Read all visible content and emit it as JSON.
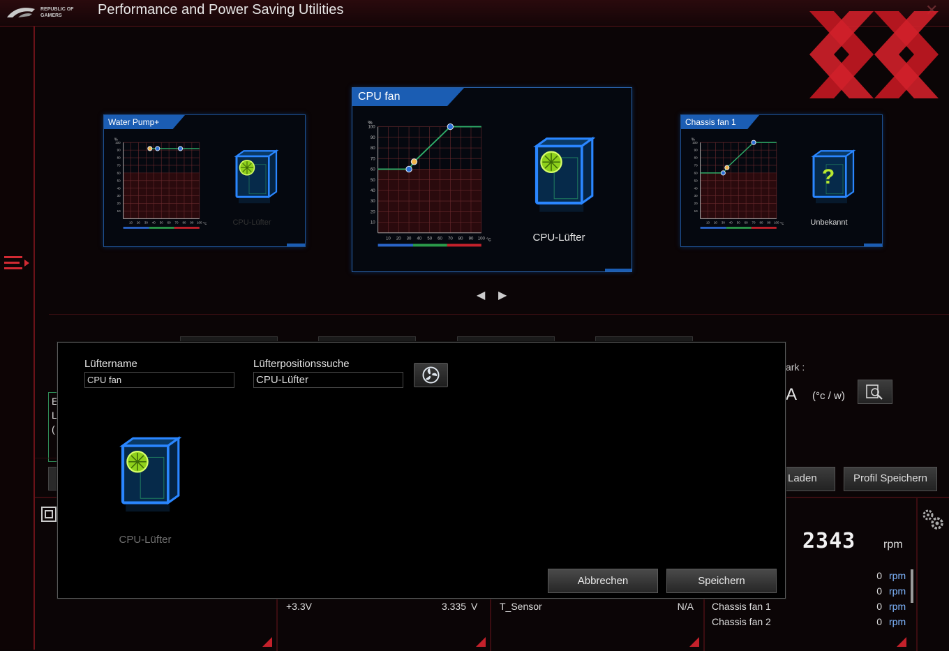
{
  "app": {
    "brand_line1": "REPUBLIC OF",
    "brand_line2": "GAMERS",
    "title": "Performance and Power Saving Utilities",
    "close": "✕"
  },
  "colors": {
    "accent_red": "#c4212b",
    "card_blue": "#1b5db3",
    "fan_green": "#a8e020"
  },
  "fan_cards": {
    "left": {
      "tab": "Water Pump+",
      "fan_label": "CPU-Lüfter"
    },
    "center": {
      "tab": "CPU fan",
      "fan_label": "CPU-Lüfter"
    },
    "right": {
      "tab": "Chassis fan 1",
      "fan_label": "Unbekannt",
      "unknown_glyph": "?"
    }
  },
  "chart_axes": {
    "y_unit": "%",
    "x_unit": "°c",
    "y_ticks": [
      "100",
      "90",
      "80",
      "70",
      "60",
      "50",
      "40",
      "30",
      "20",
      "10"
    ],
    "x_ticks": [
      "10",
      "20",
      "30",
      "40",
      "50",
      "60",
      "70",
      "80",
      "90",
      "100"
    ]
  },
  "chart_data": [
    {
      "type": "line",
      "title": "Water Pump+",
      "xlabel": "°c",
      "ylabel": "%",
      "xlim": [
        0,
        100
      ],
      "ylim": [
        0,
        100
      ],
      "x": [
        35,
        45,
        75,
        100
      ],
      "y": [
        92,
        92,
        92,
        92
      ]
    },
    {
      "type": "line",
      "title": "CPU fan",
      "xlabel": "°c",
      "ylabel": "%",
      "xlim": [
        0,
        100
      ],
      "ylim": [
        0,
        100
      ],
      "x": [
        0,
        30,
        35,
        70,
        100
      ],
      "y": [
        60,
        60,
        67,
        100,
        100
      ]
    },
    {
      "type": "line",
      "title": "Chassis fan 1",
      "xlabel": "°c",
      "ylabel": "%",
      "xlim": [
        0,
        100
      ],
      "ylim": [
        0,
        100
      ],
      "x": [
        0,
        30,
        35,
        70,
        100
      ],
      "y": [
        60,
        60,
        67,
        100,
        100
      ]
    }
  ],
  "nav": {
    "prev": "◀",
    "next": "▶"
  },
  "dialog": {
    "fan_name_label": "Lüftername",
    "fan_name_value": "CPU fan",
    "position_label": "Lüfterpositionssuche",
    "position_value": "CPU-Lüfter",
    "preview_label": "CPU-Lüfter",
    "cancel": "Abbrechen",
    "save": "Speichern"
  },
  "background_right": {
    "mark_label": "ark :",
    "value_partial": "A",
    "unit": "(°c / w)",
    "load_button": "Laden",
    "save_profile_button": "Profil Speichern"
  },
  "left_stub_letters": [
    "E",
    "L",
    "("
  ],
  "bottom": {
    "voltage": {
      "name": "+3.3V",
      "value": "3.335",
      "unit": "V"
    },
    "temp": {
      "name": "T_Sensor",
      "value": "N/A"
    },
    "fan_speed": "2343",
    "fan_speed_unit": "rpm",
    "fans": [
      {
        "name": "",
        "value": "0",
        "unit": "rpm"
      },
      {
        "name": "",
        "value": "0",
        "unit": "rpm"
      },
      {
        "name": "Chassis fan 1",
        "value": "0",
        "unit": "rpm"
      },
      {
        "name": "Chassis fan 2",
        "value": "0",
        "unit": "rpm"
      }
    ]
  }
}
